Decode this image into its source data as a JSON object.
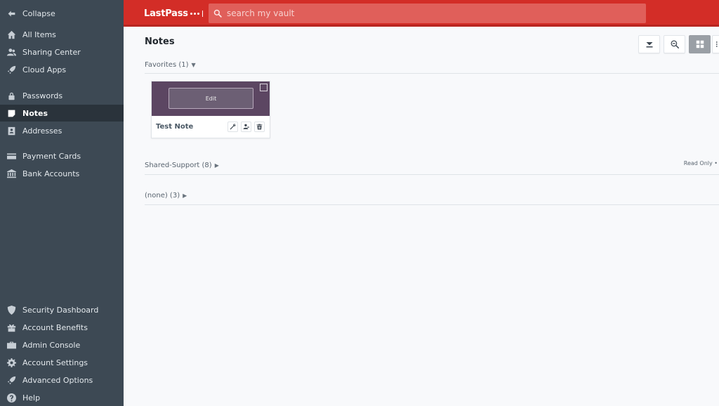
{
  "sidebar": {
    "items": [
      {
        "label": "Collapse",
        "icon": "arrow-left-icon",
        "active": false
      },
      {
        "label": "All Items",
        "icon": "home-icon",
        "active": false
      },
      {
        "label": "Sharing Center",
        "icon": "users-icon",
        "active": false
      },
      {
        "label": "Cloud Apps",
        "icon": "rocket-icon",
        "active": false
      },
      {
        "label": "Passwords",
        "icon": "lock-icon",
        "active": false
      },
      {
        "label": "Notes",
        "icon": "note-icon",
        "active": true
      },
      {
        "label": "Addresses",
        "icon": "address-book-icon",
        "active": false
      },
      {
        "label": "Payment Cards",
        "icon": "credit-card-icon",
        "active": false
      },
      {
        "label": "Bank Accounts",
        "icon": "bank-icon",
        "active": false
      },
      {
        "label": "Security Dashboard",
        "icon": "shield-icon",
        "active": false
      },
      {
        "label": "Account Benefits",
        "icon": "gift-icon",
        "active": false
      },
      {
        "label": "Admin Console",
        "icon": "briefcase-icon",
        "active": false
      },
      {
        "label": "Account Settings",
        "icon": "gear-icon",
        "active": false
      },
      {
        "label": "Advanced Options",
        "icon": "rocket-icon",
        "active": false
      },
      {
        "label": "Help",
        "icon": "help-icon",
        "active": false
      }
    ]
  },
  "header": {
    "logo": "LastPass",
    "search_placeholder": "search my vault"
  },
  "main": {
    "title": "Notes",
    "groups": [
      {
        "label": "Favorites (1)",
        "caret": "▼"
      },
      {
        "label": "Shared-Support (8)",
        "caret": "▶",
        "badge": "Read Only •"
      },
      {
        "label": "(none) (3)",
        "caret": "▶"
      }
    ],
    "card": {
      "title": "Test Note",
      "edit_label": "Edit"
    }
  },
  "colors": {
    "sidebar_bg": "#3d4954",
    "sidebar_active": "#2a333b",
    "header_red": "#d32d27",
    "card_header": "#5c4662"
  }
}
